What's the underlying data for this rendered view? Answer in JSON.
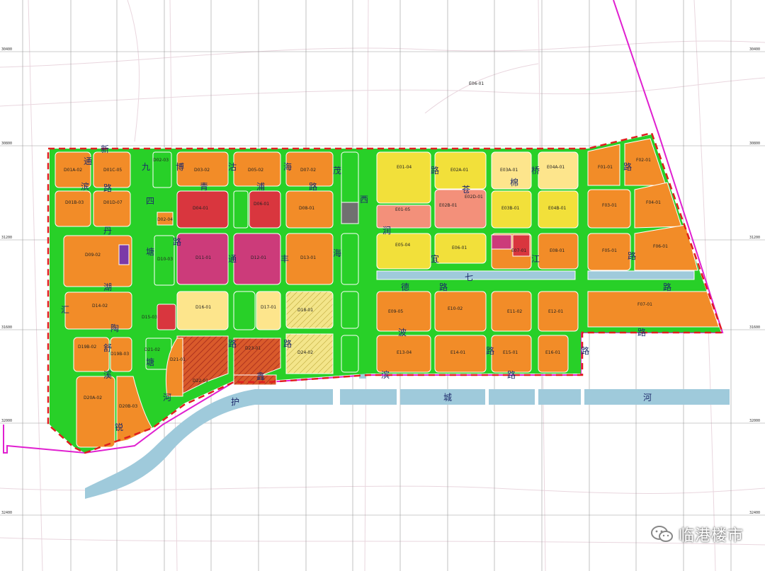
{
  "colors": {
    "residential": "#f28c28",
    "commercial": "#f2e03a",
    "mixed": "#fde58c",
    "industrial_red": "#d9363e",
    "magenta": "#cc3b7a",
    "salmon": "#f3907a",
    "green": "#28d028",
    "water": "#9fcadb",
    "boundary": "#e01e1e",
    "magenta_line": "#e020d0",
    "hatch": "#c23a22"
  },
  "grid_labels": {
    "left": [
      "30400",
      "30800",
      "31200",
      "31600",
      "32000",
      "32400"
    ],
    "right": [
      "30400",
      "30800",
      "31200",
      "31600",
      "32000",
      "32400"
    ]
  },
  "roads": [
    {
      "text": "新"
    },
    {
      "text": "城"
    },
    {
      "text": "九"
    },
    {
      "text": "博"
    },
    {
      "text": "沽"
    },
    {
      "text": "海"
    },
    {
      "text": "茂"
    },
    {
      "text": "路"
    },
    {
      "text": "桥"
    },
    {
      "text": "通"
    },
    {
      "text": "路"
    },
    {
      "text": "滨"
    },
    {
      "text": "四"
    },
    {
      "text": "青"
    },
    {
      "text": "浦"
    },
    {
      "text": "路"
    },
    {
      "text": "西"
    },
    {
      "text": "苍"
    },
    {
      "text": "棉"
    },
    {
      "text": "路"
    },
    {
      "text": "丹"
    },
    {
      "text": "塘"
    },
    {
      "text": "润"
    },
    {
      "text": "宜"
    },
    {
      "text": "路"
    },
    {
      "text": "海"
    },
    {
      "text": "江"
    },
    {
      "text": "路"
    },
    {
      "text": "通"
    },
    {
      "text": "丰"
    },
    {
      "text": "路"
    },
    {
      "text": "湖"
    },
    {
      "text": "汇"
    },
    {
      "text": "德"
    },
    {
      "text": "路"
    },
    {
      "text": "陶"
    },
    {
      "text": "舒"
    },
    {
      "text": "塘"
    },
    {
      "text": "路"
    },
    {
      "text": "波"
    },
    {
      "text": "路"
    },
    {
      "text": "滨"
    },
    {
      "text": "溪"
    },
    {
      "text": "路"
    },
    {
      "text": "鑫"
    },
    {
      "text": "河"
    },
    {
      "text": "护"
    },
    {
      "text": "城"
    },
    {
      "text": "河"
    },
    {
      "text": "路"
    },
    {
      "text": "七"
    },
    {
      "text": "路"
    },
    {
      "text": "宜"
    },
    {
      "text": "路"
    },
    {
      "text": "锐"
    }
  ],
  "parcels": [
    "D01A-02",
    "D01C-05",
    "D01B-03",
    "D01D-07",
    "D02-03",
    "D02-04",
    "D03-02",
    "D04-01",
    "D05-02",
    "D06-01",
    "D07-02",
    "D08-01",
    "D09-02",
    "D10-03",
    "D11-01",
    "D12-01",
    "D13-01",
    "D14-02",
    "D15-03",
    "D16-01",
    "D17-01",
    "D18-01",
    "D19B-02",
    "D19B-03",
    "D20A-02",
    "D20B-03",
    "D21-02",
    "D21-01",
    "D22-01",
    "D23-01",
    "D24-02",
    "E01-04",
    "E01-05",
    "E02A-01",
    "E02B-01",
    "E02D-01",
    "E03A-01",
    "E03B-01",
    "E04A-01",
    "E04B-01",
    "E05-04",
    "E06-01",
    "E07-01",
    "E08-01",
    "E09-05",
    "E10-02",
    "E11-02",
    "E12-01",
    "E13-04",
    "E14-01",
    "E15-01",
    "E16-01",
    "F01-01",
    "F02-01",
    "F03-01",
    "F04-01",
    "F05-01",
    "F06-01",
    "F07-01",
    "E06-01"
  ],
  "watermark": {
    "text": "临港楼市"
  }
}
